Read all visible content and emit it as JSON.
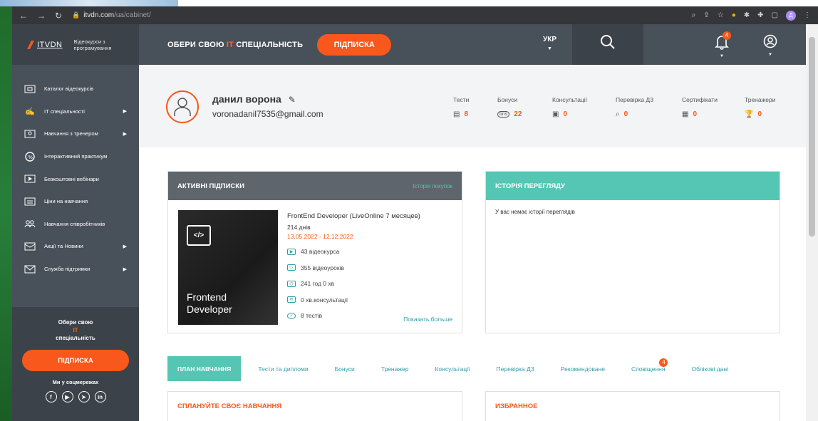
{
  "browser": {
    "url_domain": "itvdn.com",
    "url_path": "/ua/cabinet/",
    "profile_initial": "Д"
  },
  "header": {
    "logo_text": "ITVDN",
    "logo_subtitle_1": "Відеокурси з",
    "logo_subtitle_2": "програмування",
    "slogan_pre": "ОБЕРИ СВОЮ ",
    "slogan_it": "IT",
    "slogan_post": " СПЕЦІАЛЬНІСТЬ",
    "subscribe_label": "ПІДПИСКА",
    "language": "УКР",
    "notifications_count": "4"
  },
  "sidebar": {
    "items": [
      {
        "label": "Каталог відеокурсів",
        "icon": "catalog-icon"
      },
      {
        "label": "IT спеціальності",
        "icon": "specialty-icon"
      },
      {
        "label": "Навчання з тренером",
        "icon": "trainer-icon"
      },
      {
        "label": "Інтерактивний практикум",
        "icon": "practice-icon"
      },
      {
        "label": "Безкоштовні вебінари",
        "icon": "webinar-icon"
      },
      {
        "label": "Ціни на навчання",
        "icon": "prices-icon"
      },
      {
        "label": "Навчання співробітників",
        "icon": "employees-icon"
      },
      {
        "label": "Акції та Новини",
        "icon": "news-icon"
      },
      {
        "label": "Служба підтримки",
        "icon": "support-icon"
      }
    ],
    "promo_line1": "Обери свою",
    "promo_it": "IT",
    "promo_line3": "спеціальність",
    "subscribe_label": "ПІДПИСКА",
    "social_title": "Ми у соцмережах"
  },
  "profile": {
    "name": "данил ворона",
    "email": "voronadanil7535@gmail.com",
    "stats": [
      {
        "label": "Тести",
        "value": "8"
      },
      {
        "label": "Бонуси",
        "value": "22"
      },
      {
        "label": "Консультації",
        "value": "0"
      },
      {
        "label": "Перевірка ДЗ",
        "value": "0"
      },
      {
        "label": "Сертифікати",
        "value": "0"
      },
      {
        "label": "Тренажери",
        "value": "0"
      }
    ]
  },
  "subscriptions": {
    "title": "АКТИВНІ ПІДПИСКИ",
    "history_link": "Історія покупок",
    "thumb_title_1": "Frontend",
    "thumb_title_2": "Developer",
    "course_name": "FrontEnd Developer (LiveOnline 7 месяцев)",
    "days": "214 днів",
    "dates": "13.05.2022 - 12.12.2022",
    "features": [
      "43 відеокурса",
      "355 відеоуроків",
      "241 год 0 хв",
      "0 хв.консультації",
      "8 тестів"
    ],
    "show_more": "Показать больше"
  },
  "history": {
    "title": "ІСТОРІЯ ПЕРЕГЛЯДУ",
    "empty_text": "У вас немає історії переглядів"
  },
  "tabs": [
    "ПЛАН НАВЧАННЯ",
    "Тести та дипломи",
    "Бонуси",
    "Тренажер",
    "Консультації",
    "Перевірка ДЗ",
    "Рекомендоване",
    "Сповіщення",
    "Облікові дані"
  ],
  "notifications_tab_count": "4",
  "plan_card": {
    "title": "СПЛАНУЙТЕ СВОЄ НАВЧАННЯ"
  },
  "favorites_card": {
    "title": "ИЗБРАННОЕ"
  },
  "colors": {
    "accent": "#f8581b",
    "teal": "#55c5b4",
    "dark": "#485059"
  }
}
